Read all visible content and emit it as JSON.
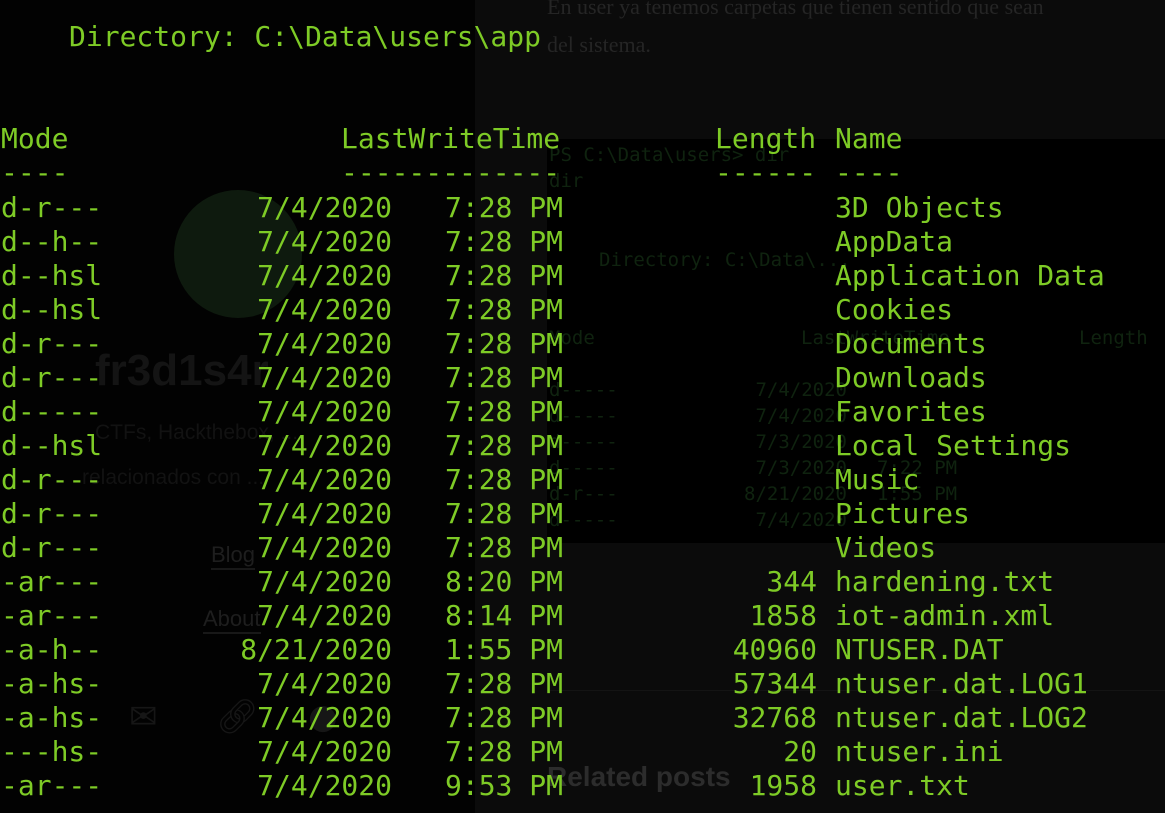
{
  "background": {
    "site_title": "fr3d1s4r",
    "site_desc_line1": "CTFs, Hackthebox, ...",
    "site_desc_line2": "relacionados con ...",
    "nav_blog": "Blog",
    "nav_about": "About",
    "content_line1": "En user ya tenemos carpetas que tienen sentido que sean",
    "content_line2": "del sistema.",
    "related_heading": "Related posts",
    "embedded_terminal": {
      "prompt": "PS C:\\Data\\users> dir",
      "prompt2": "dir",
      "directory": "Directory: C:\\Data\\...",
      "col_mode": "Mode",
      "col_lastwrite": "LastWriteTime",
      "col_length": "Length",
      "rows": [
        {
          "mode": "d-----",
          "date": "7/4/2020"
        },
        {
          "mode": "d-----",
          "date": "7/4/2020"
        },
        {
          "mode": "d-----",
          "date": "7/3/2020"
        },
        {
          "mode": "d-----",
          "date": "7/3/2020",
          "time": "7:22 PM"
        },
        {
          "mode": "d-r---",
          "date": "8/21/2020",
          "time": "1:55 PM"
        },
        {
          "mode": "d-----",
          "date": "7/4/2020"
        }
      ]
    }
  },
  "terminal": {
    "directory_label": "Directory: C:\\Data\\users\\app",
    "headers": {
      "mode": "Mode",
      "last_write_time": "LastWriteTime",
      "length": "Length",
      "name": "Name"
    },
    "underlines": {
      "mode": "----",
      "last_write_time": "-------------",
      "length": "------",
      "name": "----"
    },
    "rows": [
      {
        "mode": "d-r---",
        "date": "7/4/2020",
        "time": "7:28 PM",
        "length": "",
        "name": "3D Objects"
      },
      {
        "mode": "d--h--",
        "date": "7/4/2020",
        "time": "7:28 PM",
        "length": "",
        "name": "AppData"
      },
      {
        "mode": "d--hsl",
        "date": "7/4/2020",
        "time": "7:28 PM",
        "length": "",
        "name": "Application Data"
      },
      {
        "mode": "d--hsl",
        "date": "7/4/2020",
        "time": "7:28 PM",
        "length": "",
        "name": "Cookies"
      },
      {
        "mode": "d-r---",
        "date": "7/4/2020",
        "time": "7:28 PM",
        "length": "",
        "name": "Documents"
      },
      {
        "mode": "d-r---",
        "date": "7/4/2020",
        "time": "7:28 PM",
        "length": "",
        "name": "Downloads"
      },
      {
        "mode": "d-----",
        "date": "7/4/2020",
        "time": "7:28 PM",
        "length": "",
        "name": "Favorites"
      },
      {
        "mode": "d--hsl",
        "date": "7/4/2020",
        "time": "7:28 PM",
        "length": "",
        "name": "Local Settings"
      },
      {
        "mode": "d-r---",
        "date": "7/4/2020",
        "time": "7:28 PM",
        "length": "",
        "name": "Music"
      },
      {
        "mode": "d-r---",
        "date": "7/4/2020",
        "time": "7:28 PM",
        "length": "",
        "name": "Pictures"
      },
      {
        "mode": "d-r---",
        "date": "7/4/2020",
        "time": "7:28 PM",
        "length": "",
        "name": "Videos"
      },
      {
        "mode": "-ar---",
        "date": "7/4/2020",
        "time": "8:20 PM",
        "length": "344",
        "name": "hardening.txt"
      },
      {
        "mode": "-ar---",
        "date": "7/4/2020",
        "time": "8:14 PM",
        "length": "1858",
        "name": "iot-admin.xml"
      },
      {
        "mode": "-a-h--",
        "date": "8/21/2020",
        "time": "1:55 PM",
        "length": "40960",
        "name": "NTUSER.DAT"
      },
      {
        "mode": "-a-hs-",
        "date": "7/4/2020",
        "time": "7:28 PM",
        "length": "57344",
        "name": "ntuser.dat.LOG1"
      },
      {
        "mode": "-a-hs-",
        "date": "7/4/2020",
        "time": "7:28 PM",
        "length": "32768",
        "name": "ntuser.dat.LOG2"
      },
      {
        "mode": "---hs-",
        "date": "7/4/2020",
        "time": "7:28 PM",
        "length": "20",
        "name": "ntuser.ini"
      },
      {
        "mode": "-ar---",
        "date": "7/4/2020",
        "time": "9:53 PM",
        "length": "1958",
        "name": "user.txt"
      }
    ]
  },
  "colors": {
    "terminal_text": "#7ecb26",
    "background": "#000000",
    "dimmed_page": "#0b0b0b"
  }
}
